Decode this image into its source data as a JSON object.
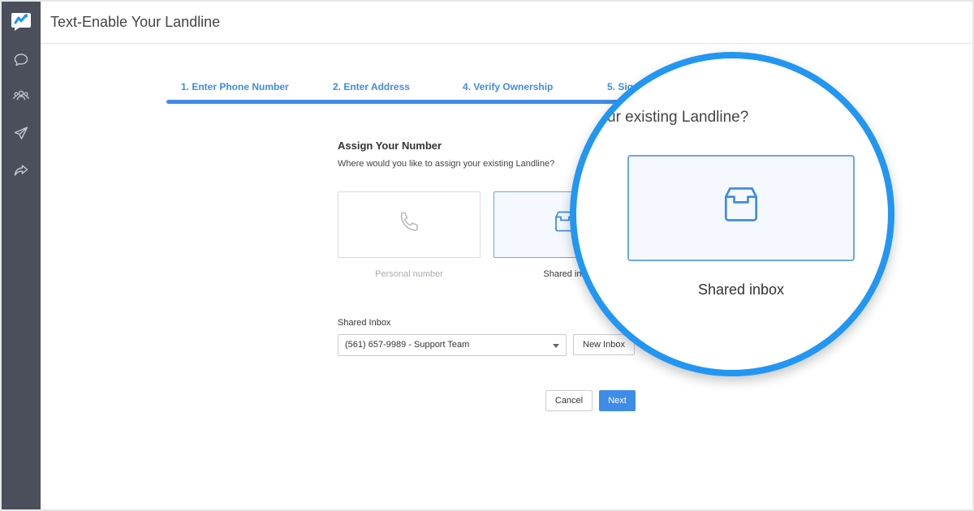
{
  "header": {
    "title": "Text-Enable Your Landline"
  },
  "sidebar": {
    "icons": [
      "chat-bubble-icon",
      "contacts-group-icon",
      "send-paper-plane-icon",
      "forward-share-icon"
    ]
  },
  "steps": [
    {
      "label": "1. Enter Phone Number"
    },
    {
      "label": "2. Enter Address"
    },
    {
      "label": "4. Verify Ownership"
    },
    {
      "label": "5. Sig"
    }
  ],
  "assign": {
    "title": "Assign Your Number",
    "subtitle": "Where would you like to assign your existing Landline?",
    "options": [
      {
        "label": "Personal number",
        "icon": "phone-icon",
        "selected": false
      },
      {
        "label": "Shared inb",
        "icon": "inbox-tray-icon",
        "selected": true
      }
    ]
  },
  "shared_inbox": {
    "label": "Shared Inbox",
    "selected_value": "(561) 657-9989 - Support Team",
    "new_button": "New Inbox"
  },
  "actions": {
    "cancel": "Cancel",
    "next": "Next"
  },
  "zoom": {
    "text": "ur existing Landline?",
    "card_label": "Shared inbox"
  },
  "colors": {
    "accent": "#3f8ce6",
    "zoom_ring": "#2196f3",
    "sidebar": "#4a4f5b"
  }
}
